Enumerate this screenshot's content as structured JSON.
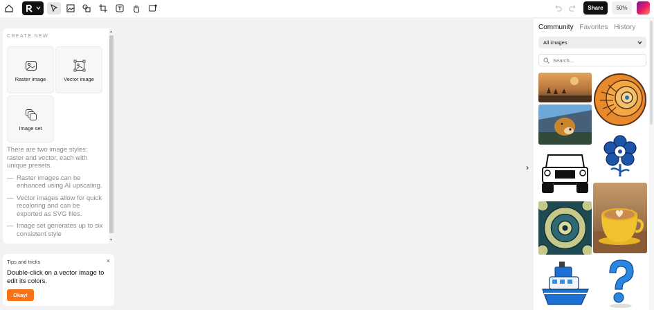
{
  "toolbar": {
    "share_label": "Share",
    "zoom_label": "50%",
    "icons": [
      "home-icon",
      "brand-logo-icon",
      "select-tool-icon",
      "image-frame-icon",
      "shapes-icon",
      "crop-icon",
      "text-icon",
      "hand-icon",
      "image-upload-icon",
      "undo-icon",
      "redo-icon"
    ]
  },
  "left_panel": {
    "section_title": "CREATE NEW",
    "tiles": [
      {
        "label": "Raster image"
      },
      {
        "label": "Vector image"
      },
      {
        "label": "Image set"
      }
    ],
    "description": "There are two image styles: raster and vector, each with unique presets.",
    "bullets": [
      "Raster images can be enhanced using AI upscaling.",
      "Vector images allow for quick recoloring and can be exported as SVG files.",
      "Image set generates up to six consistent style"
    ]
  },
  "tips": {
    "title": "Tips and tricks",
    "close": "×",
    "text": "Double-click on a vector image to edit its colors.",
    "button": "Okay!"
  },
  "right_panel": {
    "tabs": [
      {
        "label": "Community",
        "active": true
      },
      {
        "label": "Favorites",
        "active": false
      },
      {
        "label": "History",
        "active": false
      }
    ],
    "filter_value": "All images",
    "search_placeholder": "Search...",
    "images": [
      "desert-riders-image",
      "nautilus-shell-image",
      "dog-in-car-image",
      "blue-flower-image",
      "truck-outline-image",
      "latte-cup-image",
      "mandala-tile-image",
      "toy-boat-image",
      "question-mark-image"
    ]
  },
  "colors": {
    "accent": "#f97316",
    "dark": "#111111"
  }
}
